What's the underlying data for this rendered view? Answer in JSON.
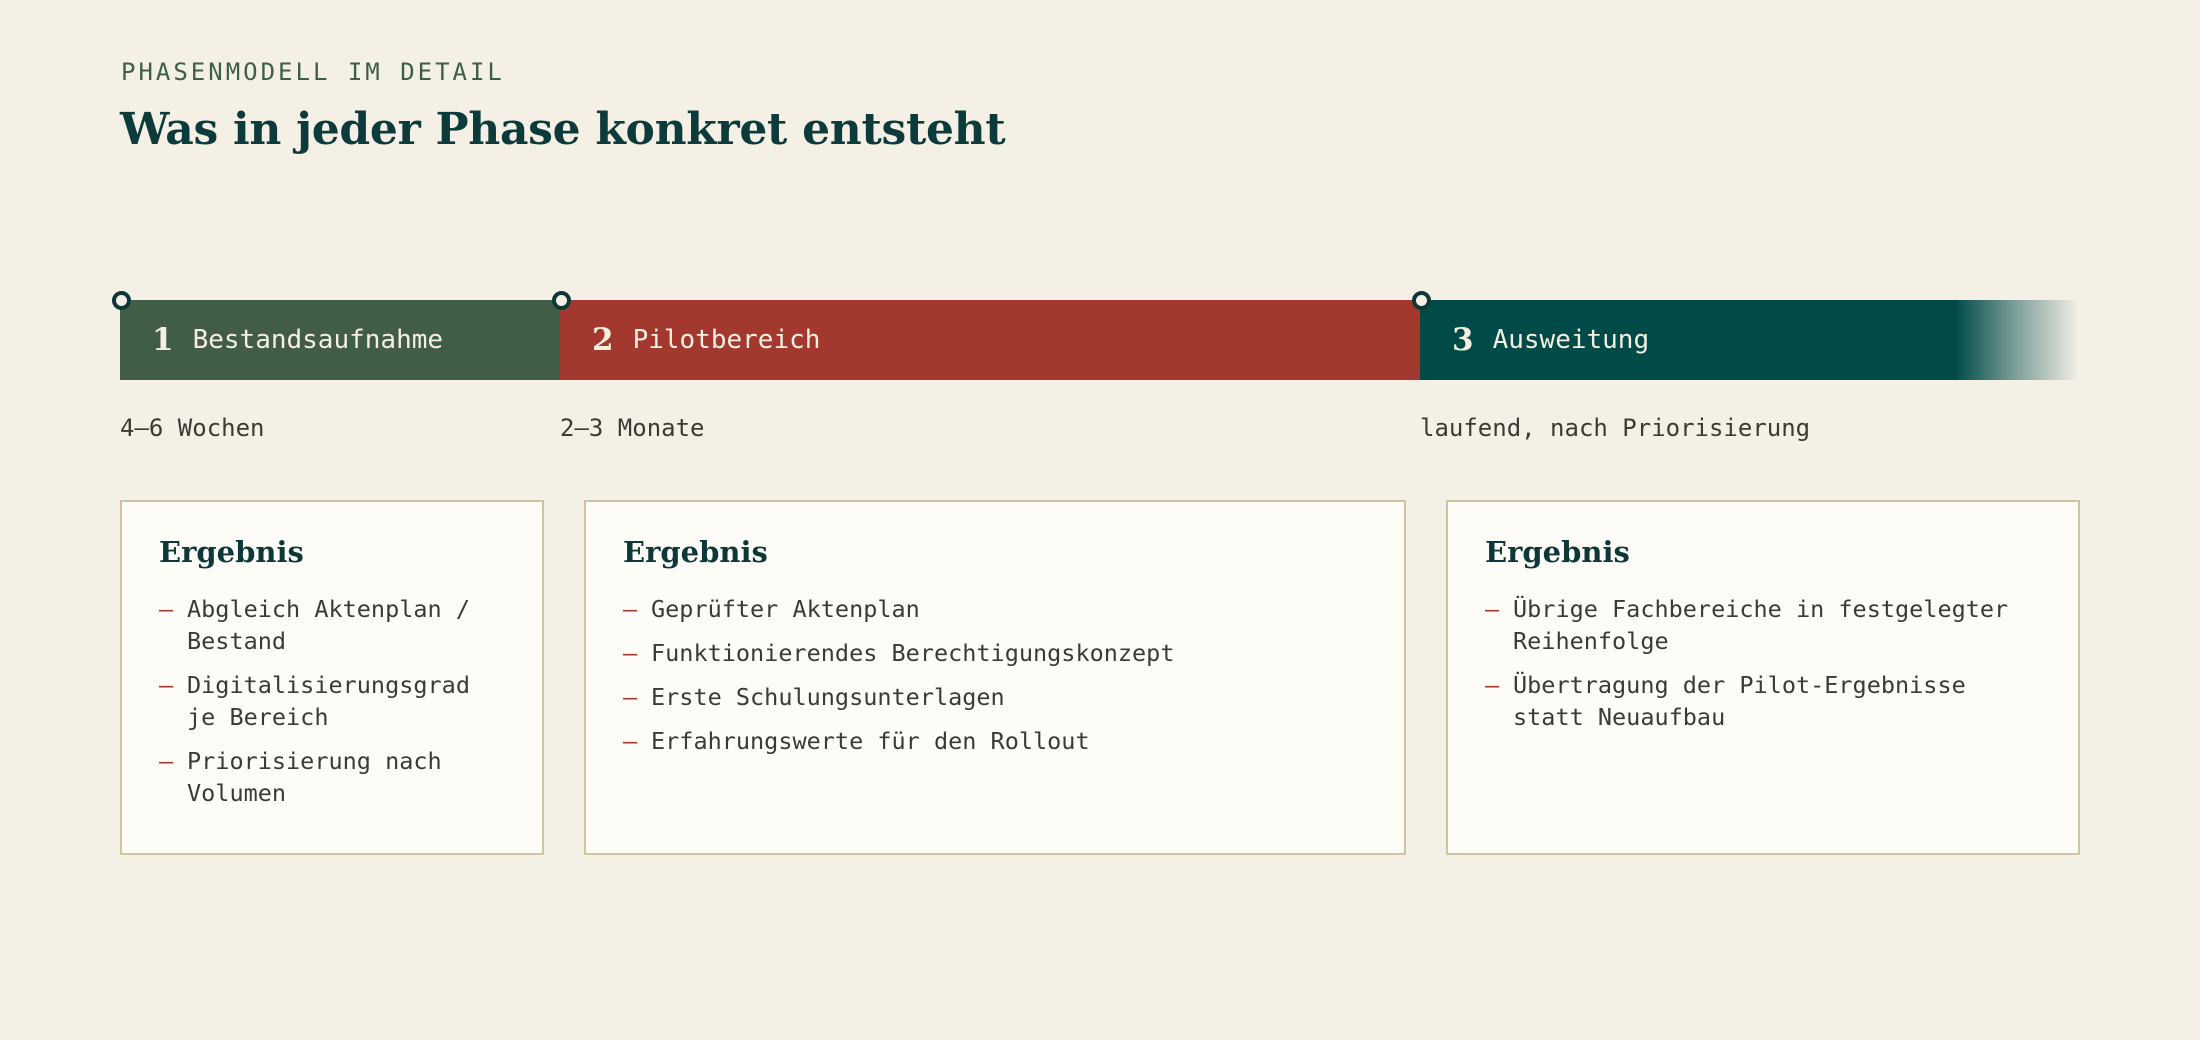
{
  "header": {
    "eyebrow": "PHASENMODELL IM DETAIL",
    "title": "Was in jeder Phase konkret entsteht"
  },
  "colors": {
    "background": "#f4f0e6",
    "phase1": "#415d47",
    "phase2": "#a3382e",
    "phase3": "#004a48",
    "accent_dash": "#a3382e",
    "card_border": "#cfc3a0"
  },
  "phases": [
    {
      "number": "1",
      "name": "Bestandsaufnahme",
      "duration": "4–6 Wochen",
      "result_title": "Ergebnis",
      "results": [
        "Abgleich Aktenplan / Bestand",
        "Digitalisierungsgrad je Bereich",
        "Priorisierung nach Volumen"
      ]
    },
    {
      "number": "2",
      "name": "Pilotbereich",
      "duration": "2–3 Monate",
      "result_title": "Ergebnis",
      "results": [
        "Geprüfter Aktenplan",
        "Funktionierendes Berechtigungskonzept",
        "Erste Schulungsunterlagen",
        "Erfahrungswerte für den Rollout"
      ]
    },
    {
      "number": "3",
      "name": "Ausweitung",
      "duration": "laufend, nach Priorisierung",
      "result_title": "Ergebnis",
      "results": [
        "Übrige Fachbereiche in festgelegter Reihenfolge",
        "Übertragung der Pilot-Ergebnisse statt Neuaufbau"
      ]
    }
  ],
  "bullet_marker": "–"
}
